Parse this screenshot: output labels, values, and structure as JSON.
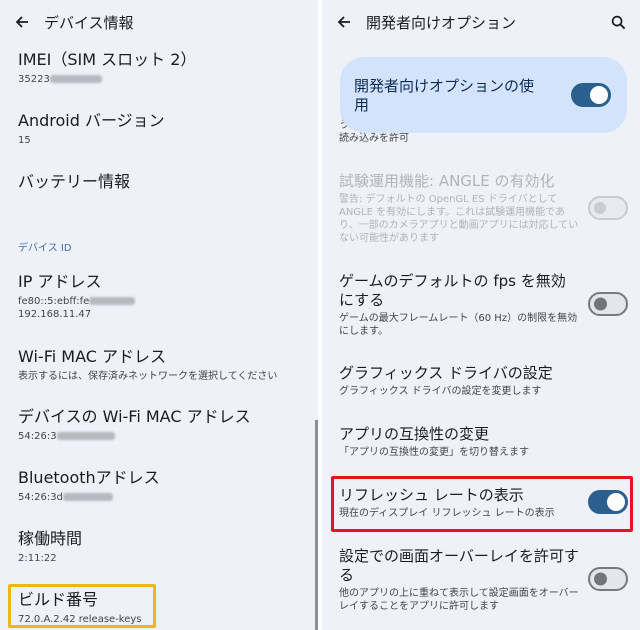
{
  "left": {
    "title": "デバイス情報",
    "items": [
      {
        "title": "IMEI（SIM スロット 2）",
        "sub": "35223"
      },
      {
        "title": "Android バージョン",
        "sub": "15"
      },
      {
        "title": "バッテリー情報",
        "sub": ""
      },
      {
        "title": "IP アドレス",
        "sub1": "fe80::5:ebff:fe",
        "sub2": "192.168.11.47"
      },
      {
        "title": "Wi-Fi MAC アドレス",
        "sub": "表示するには、保存済みネットワークを選択してください"
      },
      {
        "title": "デバイスの Wi-Fi MAC アドレス",
        "sub": "54:26:3"
      },
      {
        "title": "Bluetoothアドレス",
        "sub": "54:26:3d"
      },
      {
        "title": "稼働時間",
        "sub": "2:11:22"
      },
      {
        "title": "ビルド番号",
        "sub": "72.0.A.2.42 release-keys"
      }
    ],
    "section_header": "デバイス ID"
  },
  "right": {
    "title": "開発者向けオプション",
    "master": {
      "label": "開発者向けオプションの使用",
      "enabled": true
    },
    "partial_item": {
      "title": "う",
      "sub": "読み込みを許可"
    },
    "items": [
      {
        "title": "試験運用機能: ANGLE の有効化",
        "sub": "警告: デフォルトの OpenGL ES ドライバとして ANGLE を有効にします。これは試験運用機能であり、一部のカメラアプリと動画アプリには対応していない可能性があります",
        "toggle": "disabled"
      },
      {
        "title": "ゲームのデフォルトの fps を無効にする",
        "sub": "ゲームの最大フレームレート（60 Hz）の制限を無効にします。",
        "toggle": "off"
      },
      {
        "title": "グラフィックス ドライバの設定",
        "sub": "グラフィックス ドライバの設定を変更します",
        "toggle": "none"
      },
      {
        "title": "アプリの互換性の変更",
        "sub": "「アプリの互換性の変更」を切り替えます",
        "toggle": "none"
      },
      {
        "title": "リフレッシュ レートの表示",
        "sub": "現在のディスプレイ リフレッシュ レートの表示",
        "toggle": "on"
      },
      {
        "title": "設定での画面オーバーレイを許可する",
        "sub": "他のアプリの上に重ねて表示して設定画面をオーバーレイすることをアプリに許可します",
        "toggle": "off"
      }
    ]
  },
  "colors": {
    "background": "#eef1f8",
    "toggle_on": "#2b5f8d",
    "master_card": "#d4e3fc",
    "highlight_yellow": "#f4b223",
    "highlight_red": "#e8131e",
    "section_header": "#3e6fa8"
  },
  "icons": {
    "back": "arrow-left-icon",
    "search": "search-icon"
  }
}
